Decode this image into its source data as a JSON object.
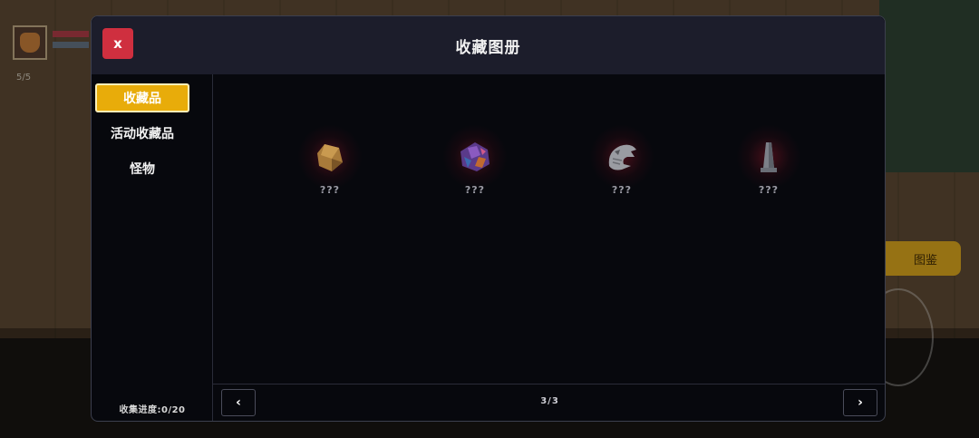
{
  "hud": {
    "ammo_count": "5/5"
  },
  "side_button": {
    "label": "图鉴"
  },
  "dialog": {
    "title": "收藏图册",
    "close_label": "x",
    "tabs": [
      {
        "label": "收藏品",
        "active": true
      },
      {
        "label": "活动收藏品",
        "active": false
      },
      {
        "label": "怪物",
        "active": false
      }
    ],
    "progress": "收集进度:0/20",
    "items": [
      {
        "name": "???",
        "icon": "amber-crystal-icon"
      },
      {
        "name": "???",
        "icon": "purple-gem-cluster-icon"
      },
      {
        "name": "???",
        "icon": "dragon-skull-icon"
      },
      {
        "name": "???",
        "icon": "stone-obelisk-icon"
      }
    ],
    "pagination": {
      "prev_label": "‹",
      "next_label": "›",
      "page_text": "3/3"
    }
  },
  "colors": {
    "accent": "#e8ac0a",
    "close": "#cf2f3f",
    "header_bg": "#1c1d2b",
    "panel_bg": "#07080d"
  }
}
